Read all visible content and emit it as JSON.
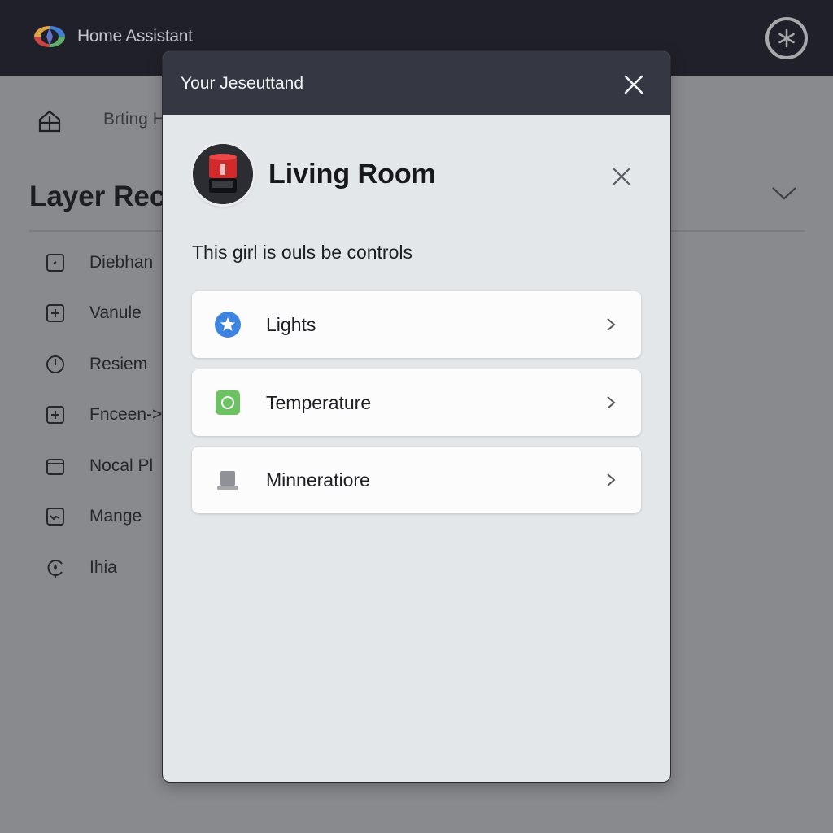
{
  "app": {
    "title": "Home Assistant",
    "logo_icon": "home-assistant-logo",
    "top_action_icon": "asterisk-circle-icon"
  },
  "background_page": {
    "breadcrumb_icon": "home-icon",
    "breadcrumb": "Brting H",
    "title": "Layer Rec",
    "collapse_icon": "chevron-down-icon",
    "nav_items": [
      {
        "label": "Diebhan",
        "icon": "square-dot-icon"
      },
      {
        "label": "Vanule",
        "icon": "square-plus-icon"
      },
      {
        "label": "Resiem",
        "icon": "power-icon"
      },
      {
        "label": "Fnceen->",
        "icon": "square-plus-icon"
      },
      {
        "label": "Nocal Pl",
        "icon": "box-icon"
      },
      {
        "label": "Mange",
        "icon": "chart-square-icon"
      },
      {
        "label": "Ihia",
        "icon": "water-drop-icon"
      }
    ]
  },
  "modal": {
    "title": "Your Jeseuttand",
    "close_icon": "close-icon",
    "room": {
      "title": "Living Room",
      "avatar": "smart-speaker-image",
      "close_icon": "close-icon",
      "description": "This girl is ouls be controls"
    },
    "cards": [
      {
        "label": "Lights",
        "icon": "star-circle-icon",
        "color": "#3d83e0"
      },
      {
        "label": "Temperature",
        "icon": "thermostat-square-icon",
        "color": "#6cc262"
      },
      {
        "label": "Minneratiore",
        "icon": "device-hat-icon",
        "color": "#8f9197"
      }
    ]
  }
}
